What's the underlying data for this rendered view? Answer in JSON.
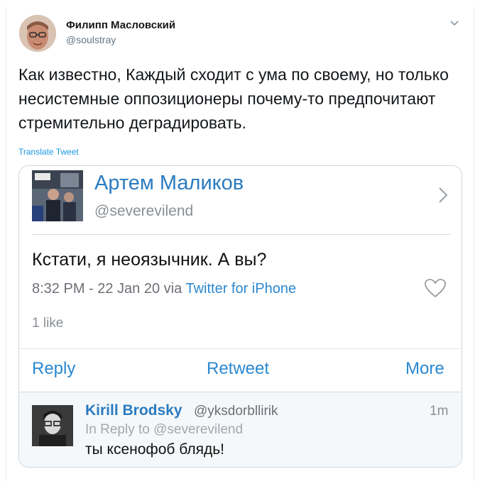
{
  "tweet": {
    "author": {
      "name": "Филипп Масловский",
      "handle": "@soulstray"
    },
    "text": "Как известно, Каждый сходит с ума по своему, но только несистемные оппозиционеры почему-то предпочитают стремительно деградировать.",
    "translate_label": "Translate Tweet",
    "menu_icon": "chevron-down-icon"
  },
  "embedded_screenshot": {
    "author": {
      "name": "Артем Маликов",
      "handle": "@severevilend"
    },
    "text": "Кстати, я неоязычник. А вы?",
    "timestamp": "8:32 PM - 22 Jan 20",
    "via_prefix": "via",
    "via_app": "Twitter for iPhone",
    "likes": "1 like",
    "actions": {
      "reply": "Reply",
      "retweet": "Retweet",
      "more": "More"
    },
    "reply": {
      "name": "Kirill Brodsky",
      "handle": "@yksdorbllirik",
      "time": "1m",
      "in_reply_to": "In Reply to @severevilend",
      "text": "ты ксенофоб блядь!"
    }
  },
  "colors": {
    "link_blue": "#1b95e0",
    "ios_blue": "#2b88d0",
    "text_dark": "#14171a",
    "muted_gray": "#657786"
  }
}
